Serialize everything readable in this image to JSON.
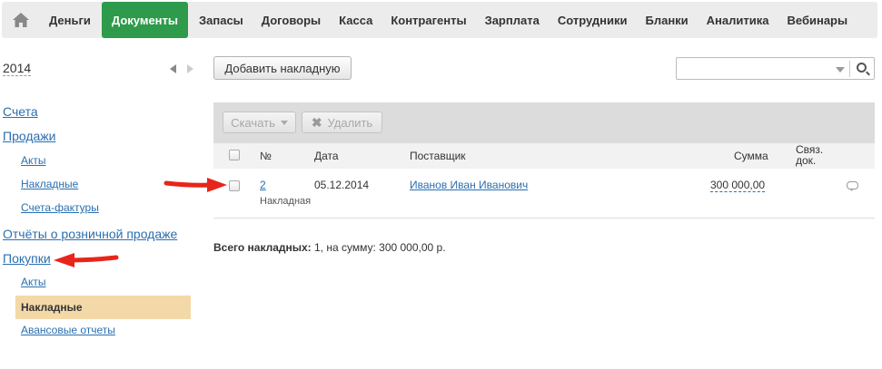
{
  "nav": {
    "items": [
      {
        "label": "Деньги",
        "active": false
      },
      {
        "label": "Документы",
        "active": true
      },
      {
        "label": "Запасы",
        "active": false
      },
      {
        "label": "Договоры",
        "active": false
      },
      {
        "label": "Касса",
        "active": false
      },
      {
        "label": "Контрагенты",
        "active": false
      },
      {
        "label": "Зарплата",
        "active": false
      },
      {
        "label": "Сотрудники",
        "active": false
      },
      {
        "label": "Бланки",
        "active": false
      },
      {
        "label": "Аналитика",
        "active": false
      },
      {
        "label": "Вебинары",
        "active": false
      }
    ],
    "home_icon": "home-icon"
  },
  "sidebar": {
    "year": "2014",
    "items": [
      {
        "label": "Счета"
      },
      {
        "label": "Продажи"
      },
      {
        "label": "Акты"
      },
      {
        "label": "Накладные"
      },
      {
        "label": "Счета-фактуры"
      },
      {
        "label": "Отчёты о розничной продаже"
      },
      {
        "label": "Покупки"
      },
      {
        "label": "Акты"
      },
      {
        "label": "Накладные"
      },
      {
        "label": "Авансовые отчеты"
      }
    ]
  },
  "actions": {
    "add_label": "Добавить накладную",
    "search_placeholder": "",
    "download_label": "Скачать",
    "delete_label": "Удалить"
  },
  "table": {
    "columns": [
      "№",
      "Дата",
      "Поставщик",
      "Сумма",
      "Связ. док."
    ],
    "rows": [
      {
        "number": "2",
        "type": "Накладная",
        "date": "05.12.2014",
        "supplier": "Иванов Иван Иванович",
        "amount": "300 000,00"
      }
    ]
  },
  "summary": {
    "prefix": "Всего накладных:",
    "rest": " 1, на сумму: 300 000,00 р."
  },
  "colors": {
    "active_nav": "#2e9a4b",
    "active_sidebar": "#f3d9a8",
    "link": "#2a6fb0",
    "arrow": "#e8251a"
  }
}
